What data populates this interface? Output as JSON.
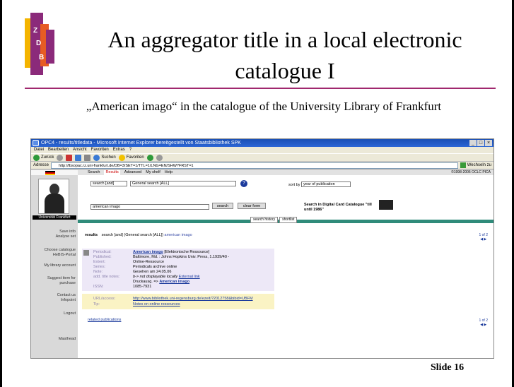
{
  "slide": {
    "title_line1": "An aggregator title in a local electronic",
    "title_line2": "catalogue I",
    "subtitle": "„American imago“ in the catalogue of the University Library of Frankfurt",
    "slide_number": "Slide 16",
    "accent_color": "#a0286e",
    "logo_letters": [
      "Z",
      "D",
      "B"
    ]
  },
  "browser": {
    "window_title": "OPC4 - results/titledata - Microsoft Internet Explorer bereitgestellt von Staatsbibliothek SPK",
    "menu": [
      "Datei",
      "Bearbeiten",
      "Ansicht",
      "Favoriten",
      "Extras",
      "?"
    ],
    "toolbar": {
      "back": "Zurück",
      "search": "Suchen",
      "favorites": "Favoriten"
    },
    "address_label": "Adresse",
    "address_url": "http://lbsopac.rz.uni-frankfurt.de/DB=3/SET=1/TTL=1/LNG=EN/SHW?FRST=1",
    "go_label": "Wechseln zu"
  },
  "opac": {
    "nav": [
      "Search",
      "Results",
      "Advanced",
      "My shelf",
      "Help"
    ],
    "active_nav": "Results",
    "copyright": "©1998-2006 OCLC PICA",
    "library_label": "Universität Frankfurt",
    "search": {
      "scope": "search [and]",
      "index": "General search [ALL]",
      "query": "american imago",
      "search_button": "search",
      "clear_button": "clear form",
      "sort_label": "sort by",
      "sort_value": "year of publication",
      "digital_card": "Search in Digital Card Catalogue \"till until 1986\""
    },
    "tabs": [
      "search history",
      "shortlist"
    ],
    "sidebar": [
      "Save info",
      "Analyse set",
      "Choose catalogue",
      "HeBIS-Portal",
      "My library account",
      "Suggest item for purchase",
      "Contact us",
      "Infopoint",
      "Logout",
      "Masthead"
    ],
    "results_header": {
      "label": "results",
      "text": "search [and] (General search [ALL])",
      "query": "american imago"
    },
    "pager": {
      "count": "1 of 2"
    },
    "record": {
      "fields": [
        {
          "label": "Periodical:",
          "value": "American imago",
          "extra": "[Elektronische Ressource]"
        },
        {
          "label": "Published:",
          "value": "Baltimore, Md. : Johns Hopkins Univ. Press, 1.1939/40 -"
        },
        {
          "label": "Extent:",
          "value": "Online-Ressource"
        },
        {
          "label": "Series:",
          "value": "Periodicals archive online"
        },
        {
          "label": "Note:",
          "value": "Gesehen am 24.05.06"
        },
        {
          "label": "add. title notes:",
          "value": "b-> not displayable locally",
          "extra": "External link"
        },
        {
          "label": "",
          "value": "Druckausg. =>",
          "extra": "American imago"
        },
        {
          "label": "ISSN:",
          "value": "1085-7931"
        }
      ],
      "url_label": "URL/access:",
      "url_value": "http://www.bibliothek.uni-regensburg.de/ezeit/?2012758&bibid=UBFM",
      "tip_label": "Tip:",
      "tip_value": "Notes on online ressources"
    },
    "related": "related publications"
  }
}
